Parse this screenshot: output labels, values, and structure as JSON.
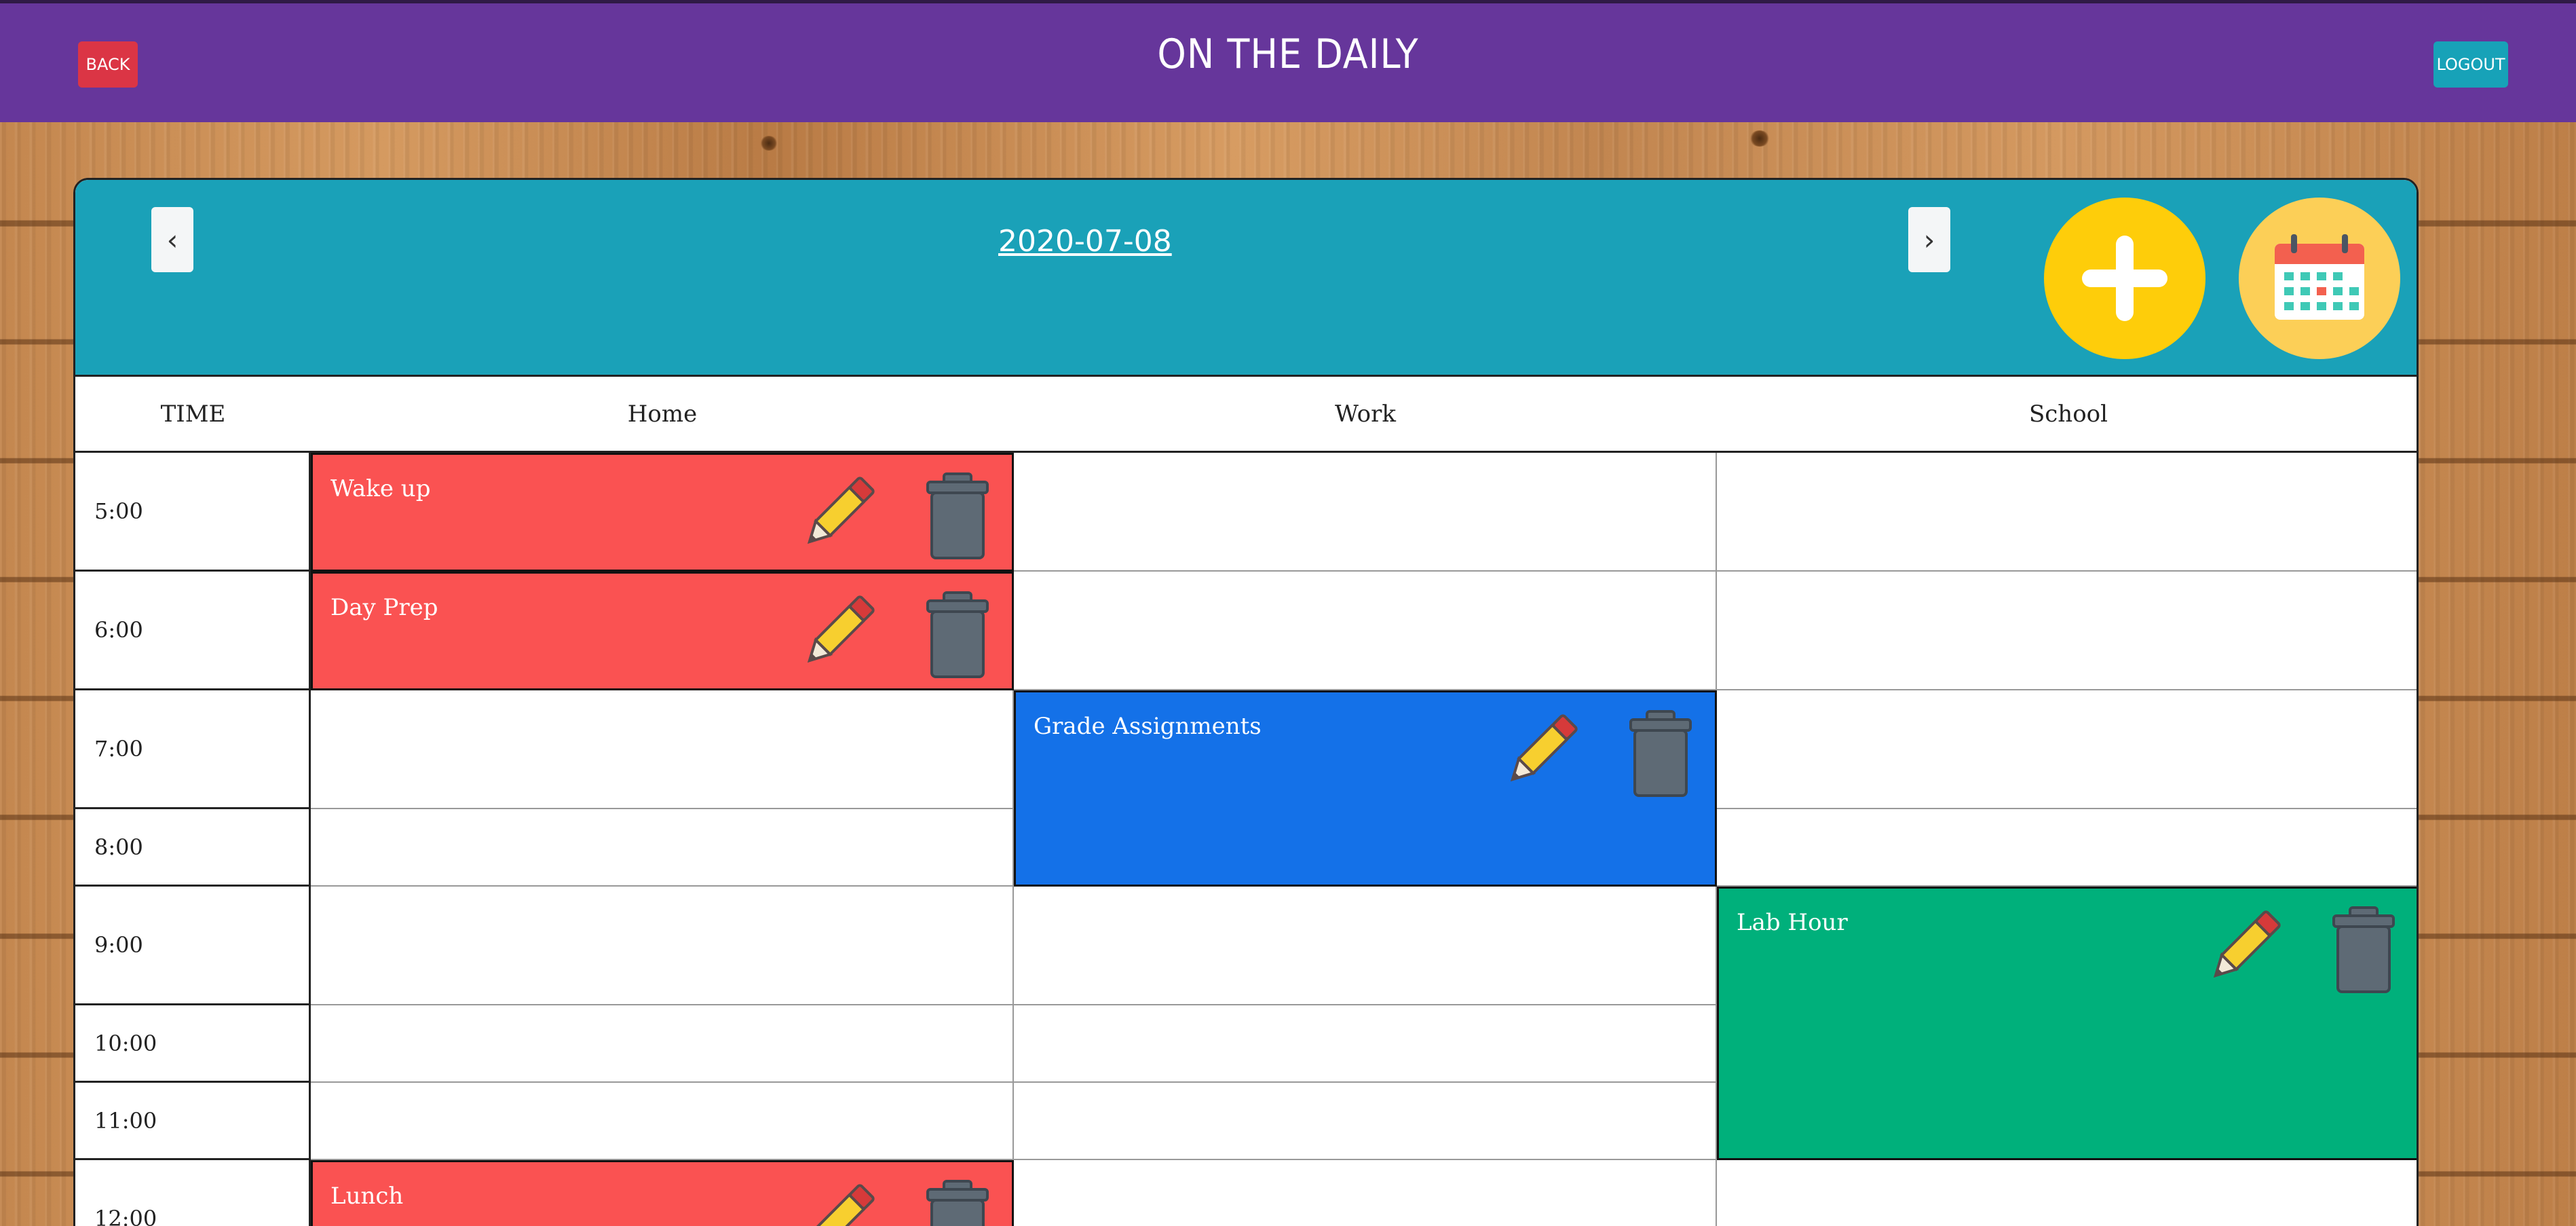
{
  "app": {
    "title": "ON THE DAILY",
    "back_label": "BACK",
    "logout_label": "LOGOUT"
  },
  "day_nav": {
    "prev_label": "‹",
    "next_label": "›",
    "date": "2020-07-08"
  },
  "colors": {
    "topbar": "#66369b",
    "header_panel": "#1aa1b8",
    "home_event": "#fa5252",
    "work_event": "#1471e8",
    "school_event": "#00b07b",
    "add_button": "#fecd0a"
  },
  "table": {
    "columns": [
      "TIME",
      "Home",
      "Work",
      "School"
    ],
    "times": [
      "5:00",
      "6:00",
      "7:00",
      "8:00",
      "9:00",
      "10:00",
      "11:00",
      "12:00"
    ]
  },
  "events": {
    "wake_up": "Wake up",
    "day_prep": "Day Prep",
    "grade_assignments": "Grade Assignments",
    "lab_hour": "Lab Hour",
    "lunch": "Lunch"
  },
  "icons": [
    "add-icon",
    "calendar-icon",
    "pencil-icon",
    "trash-icon"
  ]
}
